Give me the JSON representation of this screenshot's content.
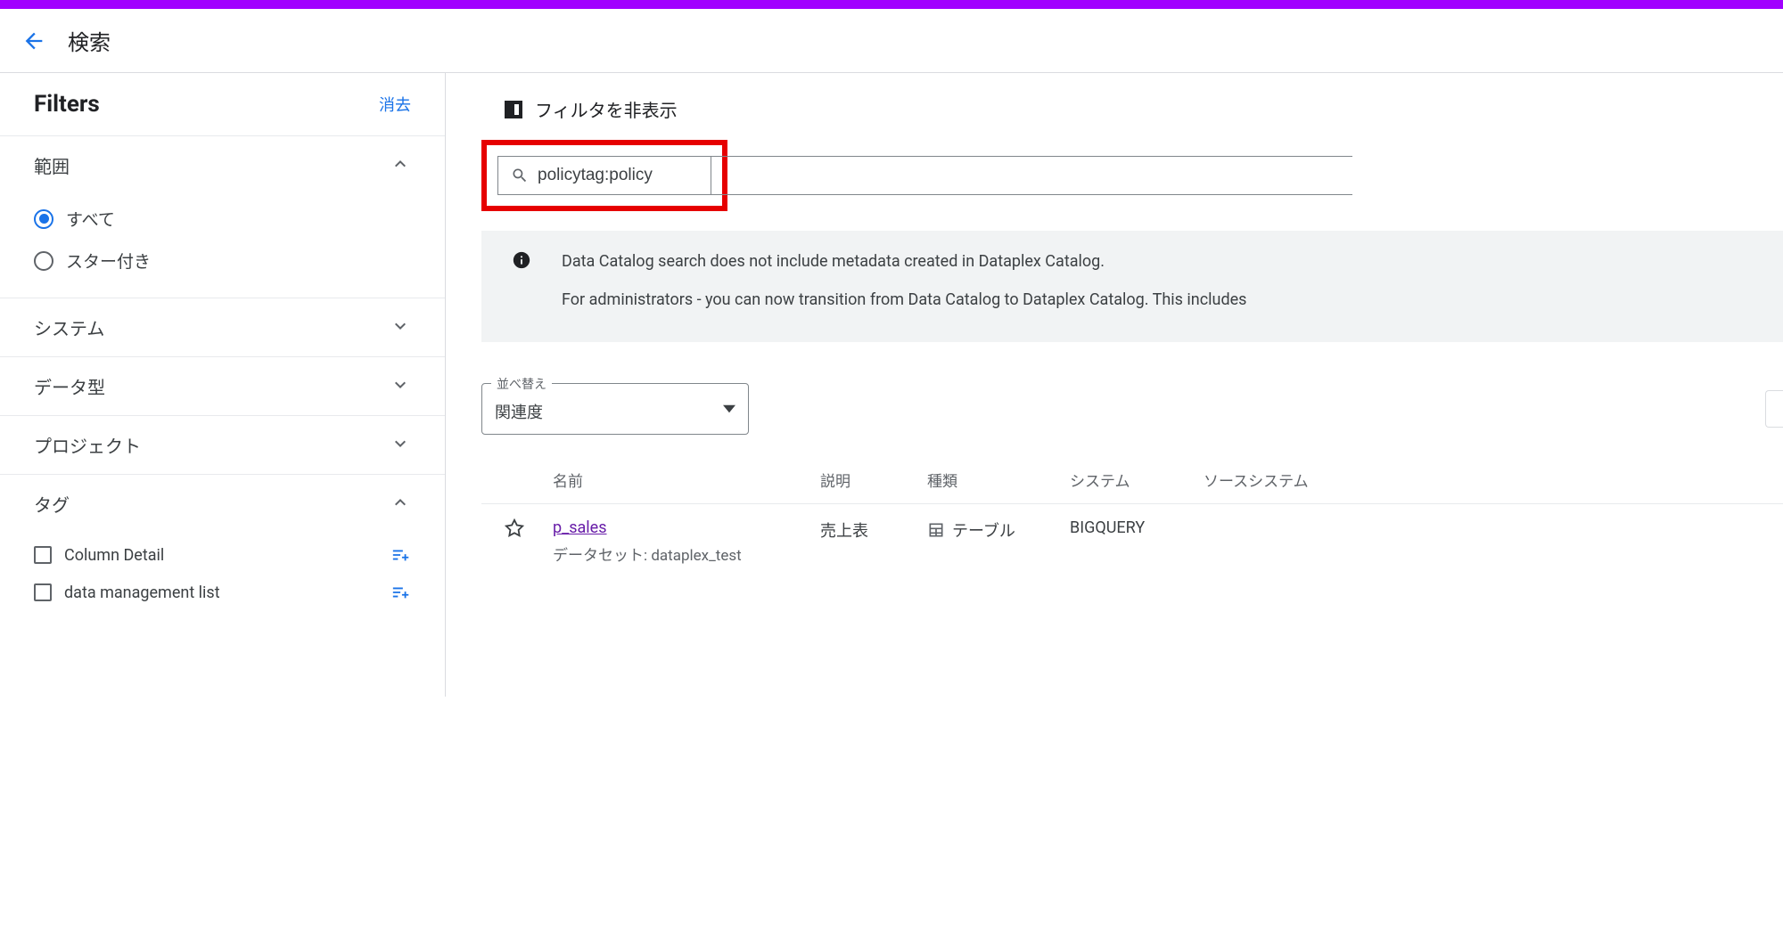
{
  "header": {
    "title": "検索"
  },
  "sidebar": {
    "filters_title": "Filters",
    "clear": "消去",
    "scope": {
      "title": "範囲",
      "options": [
        "すべて",
        "スター付き"
      ],
      "selected": 0
    },
    "sections": {
      "system": "システム",
      "datatype": "データ型",
      "project": "プロジェクト",
      "tag": "タグ"
    },
    "tags": [
      "Column Detail",
      "data management list"
    ]
  },
  "main": {
    "hide_filter": "フィルタを非表示",
    "search_value": "policytag:policy",
    "info": {
      "line1": "Data Catalog search does not include metadata created in Dataplex Catalog.",
      "line2": "For administrators - you can now transition from Data Catalog to Dataplex Catalog. This includes"
    },
    "sort": {
      "label": "並べ替え",
      "value": "関連度"
    },
    "columns": {
      "name": "名前",
      "desc": "説明",
      "type": "種類",
      "system": "システム",
      "source": "ソースシステム"
    },
    "results": [
      {
        "name": "p_sales",
        "dataset_label": "データセット:",
        "dataset_value": "dataplex_test",
        "desc": "売上表",
        "type": "テーブル",
        "system": "BIGQUERY"
      }
    ]
  }
}
